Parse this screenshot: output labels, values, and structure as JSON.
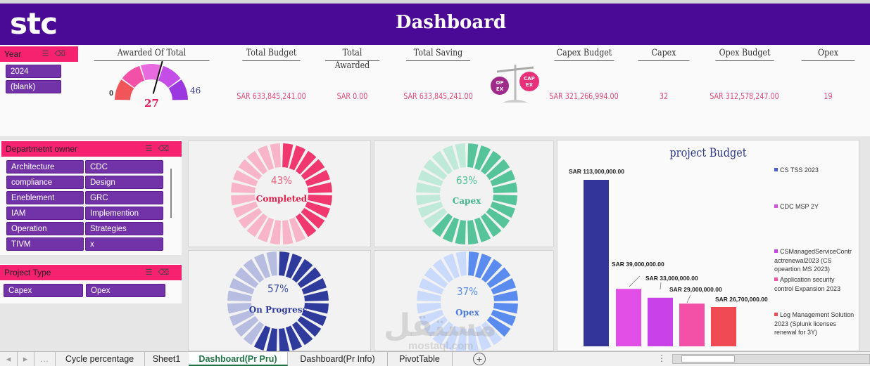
{
  "header": {
    "logo": "stc",
    "title": "Dashboard"
  },
  "year_slicer": {
    "label": "Year",
    "items": [
      "2024",
      "(blank)"
    ]
  },
  "gauge": {
    "title": "Awarded Of Total",
    "min": "0",
    "max": "46",
    "value": "27",
    "fraction": 0.587
  },
  "kpis": [
    {
      "label": "Total Budget",
      "value": "SAR 633,845,241.00"
    },
    {
      "label": "Total Awarded",
      "value": "SAR 0.00"
    },
    {
      "label": "Total Saving",
      "value": "SAR 633,845,241.00"
    },
    {
      "label": "Capex Budget",
      "value": "SAR 321,266,994.00"
    },
    {
      "label": "Capex",
      "value": "32"
    },
    {
      "label": "Opex Budget",
      "value": "SAR 312,578,247.00"
    },
    {
      "label": "Opex",
      "value": "19"
    }
  ],
  "scale_icon": {
    "left": "OP EX",
    "right": "CAP EX"
  },
  "dept_slicer": {
    "label": "Departmetnt owner",
    "items": [
      "Architecture",
      "CDC",
      "compliance",
      "Design",
      "Eneblement",
      "GRC",
      "IAM",
      "Implemention",
      "Operation",
      "Strategies",
      "TIVM",
      "x"
    ]
  },
  "type_slicer": {
    "label": "Project Type",
    "items": [
      "Capex",
      "Opex"
    ]
  },
  "donuts": [
    {
      "pct": "43%",
      "label": "Completed",
      "fraction": 0.43,
      "dark": "#f0386e",
      "light": "#f8b4c8",
      "pct_color": "#e8607e",
      "label_color": "#e11d48"
    },
    {
      "pct": "63%",
      "label": "Capex",
      "fraction": 0.63,
      "dark": "#55c49b",
      "light": "#bfe9d9",
      "pct_color": "#4fbf96",
      "label_color": "#3fb38a"
    },
    {
      "pct": "57%",
      "label": "On Progress",
      "fraction": 0.57,
      "dark": "#2e3a9c",
      "light": "#b7bde0",
      "pct_color": "#3a4aa6",
      "label_color": "#2e3a9c"
    },
    {
      "pct": "37%",
      "label": "Opex",
      "fraction": 0.37,
      "dark": "#5a8cf0",
      "light": "#c9dafc",
      "pct_color": "#5a8cf0",
      "label_color": "#4a7ae0"
    }
  ],
  "chart_data": {
    "type": "bar",
    "title": "project Budget",
    "categories": [
      "CS TSS 2023",
      "CDC MSP 2Y",
      "CSManagedServiceContractrenewal2023 (CS opeartion MS  2023)",
      "Application security control Expansion 2023",
      "Log Management Solution 2023 (Splunk licenses renewal for 3Y)"
    ],
    "values": [
      113000000,
      39000000,
      33000000,
      29000000,
      26700000
    ],
    "data_labels": [
      "SAR 113,000,000.00",
      "SAR 39,000,000.00",
      "SAR 33,000,000.00",
      "SAR 29,000,000.00",
      "SAR 26,700,000.00"
    ],
    "colors": [
      "#33359a",
      "#e14fe6",
      "#c941e8",
      "#f251a7",
      "#f04a54"
    ],
    "legend_position": "right",
    "ylim": [
      0,
      113000000
    ]
  },
  "legend": [
    {
      "label": "CS TSS 2023",
      "color": "#4c5fd6"
    },
    {
      "label": "CDC MSP 2Y",
      "color": "#d34fe0"
    },
    {
      "label": "CSManagedServiceContr actrenewal2023 (CS opeartion MS  2023)",
      "color": "#c941e8"
    },
    {
      "label": "Application security control Expansion 2023",
      "color": "#f251a7"
    },
    {
      "label": "Log Management Solution 2023 (Splunk licenses renewal for 3Y)",
      "color": "#f04a54"
    }
  ],
  "watermark": {
    "arabic": "مستقل",
    "latin": "mostaql.com"
  },
  "tabs": [
    "Cycle percentage",
    "Sheet1",
    "Dashboard(Pr Pru)",
    "Dashboard(Pr Info)",
    "PivotTable"
  ],
  "active_tab": "Dashboard(Pr Pru)"
}
